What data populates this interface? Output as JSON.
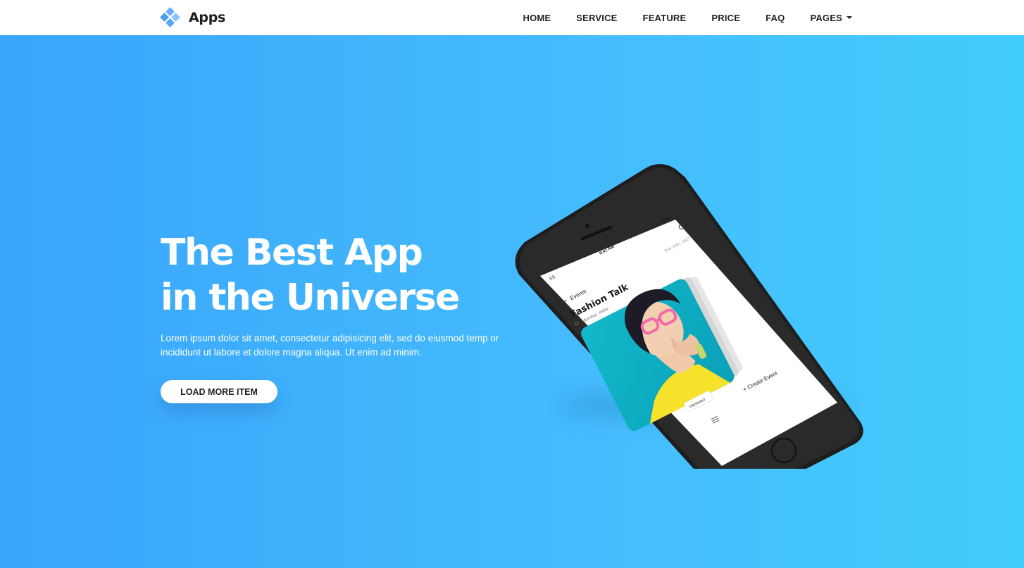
{
  "brand": {
    "name": "Apps",
    "logo_icon": "diamond-cluster-icon",
    "logo_color": "#6aaeff"
  },
  "nav": {
    "items": [
      {
        "label": "HOME"
      },
      {
        "label": "SERVICE"
      },
      {
        "label": "FEATURE"
      },
      {
        "label": "PRICE"
      },
      {
        "label": "FAQ"
      },
      {
        "label": "PAGES",
        "icon": "caret-down-icon"
      }
    ]
  },
  "hero": {
    "title_line1": "The Best App",
    "title_line2": "in the Universe",
    "description": "Lorem ipsum dolor sit amet, consectetur adipisicing elit, sed do eiusmod temp or incididunt ut labore et dolore magna aliqua. Ut enim ad minim.",
    "cta_label": "LOAD MORE ITEM",
    "gradient_start": "#3aa5fb",
    "gradient_end": "#43cdfc"
  },
  "phone": {
    "status_time": "9:41 AM",
    "status_battery": "58 %",
    "status_carrier": "GS",
    "header_label": "Events",
    "header_date": "Nov 24th, 2017",
    "event_title": "Fashion Talk",
    "event_location": "Mumbai, India",
    "badge_label": "Interested",
    "create_label": "+ Create Event"
  }
}
